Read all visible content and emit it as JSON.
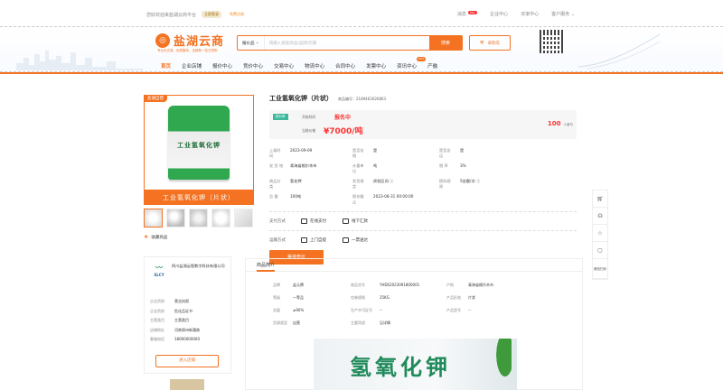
{
  "topbar": {
    "welcome": "您好欢迎来盐湖云商平台",
    "login": "立即登录",
    "register": "免费注册",
    "message": "消息",
    "badge": "99+",
    "enterprise": "企业中心",
    "buyer": "买家中心",
    "service": "客户服务"
  },
  "header": {
    "logo_name": "盐湖云商",
    "slogan": "专业化交易，优质服务，全链条一站式采购",
    "search_category": "报价品",
    "search_placeholder": "请输入搜索商品/品牌/店铺",
    "search_button": "搜索",
    "cart_label": "采购车"
  },
  "nav": {
    "items": [
      "首页",
      "企业店铺",
      "报价中心",
      "竞价中心",
      "交易中心",
      "物流中心",
      "合同中心",
      "发票中心",
      "资讯中心",
      "产融"
    ],
    "hot_label": "HOT"
  },
  "product": {
    "tag": "盐湖自营",
    "bag_text": "工业氢氧化钾",
    "caption": "工业氢氧化钾（片状）",
    "title": "工业氢氧化钾（片状）",
    "code_label": "商品编号：",
    "code": "2189463026863",
    "status_tag": "报价单",
    "open_time_label": "开始时间",
    "register_status": "报名中",
    "current_price_label": "当前价格",
    "price": "¥7000/吨",
    "count": "100",
    "count_unit": "人参与",
    "favorite": "收藏商品",
    "attrs": [
      [
        "上架时间",
        "2023-09-09",
        "是否含税",
        "是",
        "是否含运",
        "是"
      ],
      [
        "发 货 地",
        "青海省格尔木市",
        "计量单位",
        "吨",
        "税 率",
        "3%"
      ],
      [
        "商品分类",
        "氢化钾",
        "发货规定",
        "质检区间 ⓘ",
        "提料规则",
        "5金额/次 ⓘ"
      ],
      [
        "总 量",
        "100吨",
        "报名截止",
        "2023-08-31 00:00:00",
        "",
        ""
      ]
    ],
    "pay_label": "支付方式",
    "pay_options": [
      "在线支付",
      "线下汇款"
    ],
    "logistics_label": "运输方式",
    "logistics_options": [
      "上门自提",
      "一票送达"
    ],
    "enter_button": "等待竞价"
  },
  "sidebar": {
    "qr_label": "微信扫码"
  },
  "shop": {
    "logo_text": "SLCY",
    "name": "四川盐湖云智数字科技有限公司",
    "rows": [
      [
        "企业资质",
        "营业执照"
      ],
      [
        "企业资质",
        "危化品证书"
      ],
      [
        "主营类目",
        "主营类目"
      ],
      [
        "店铺地址",
        "河南郑州新蒲商"
      ],
      [
        "客服电话",
        "18000000000"
      ]
    ],
    "enter_button": "进入店铺"
  },
  "intro": {
    "tab": "商品简介",
    "rows": [
      [
        "品牌",
        "盐元牌",
        "商品货号",
        "YHDS2023091800001",
        "产地",
        "青海省格尔木市"
      ],
      [
        "等级",
        "一等品",
        "包装规格",
        "25KG",
        "产品形态",
        "片状"
      ],
      [
        "含量",
        "≥90%",
        "生产许可证号",
        "--",
        "产品型号",
        "--"
      ],
      [
        "货源类型",
        "自营",
        "主要用途",
        "见详情",
        "",
        ""
      ]
    ],
    "banner_text": "氢氧化钾"
  }
}
